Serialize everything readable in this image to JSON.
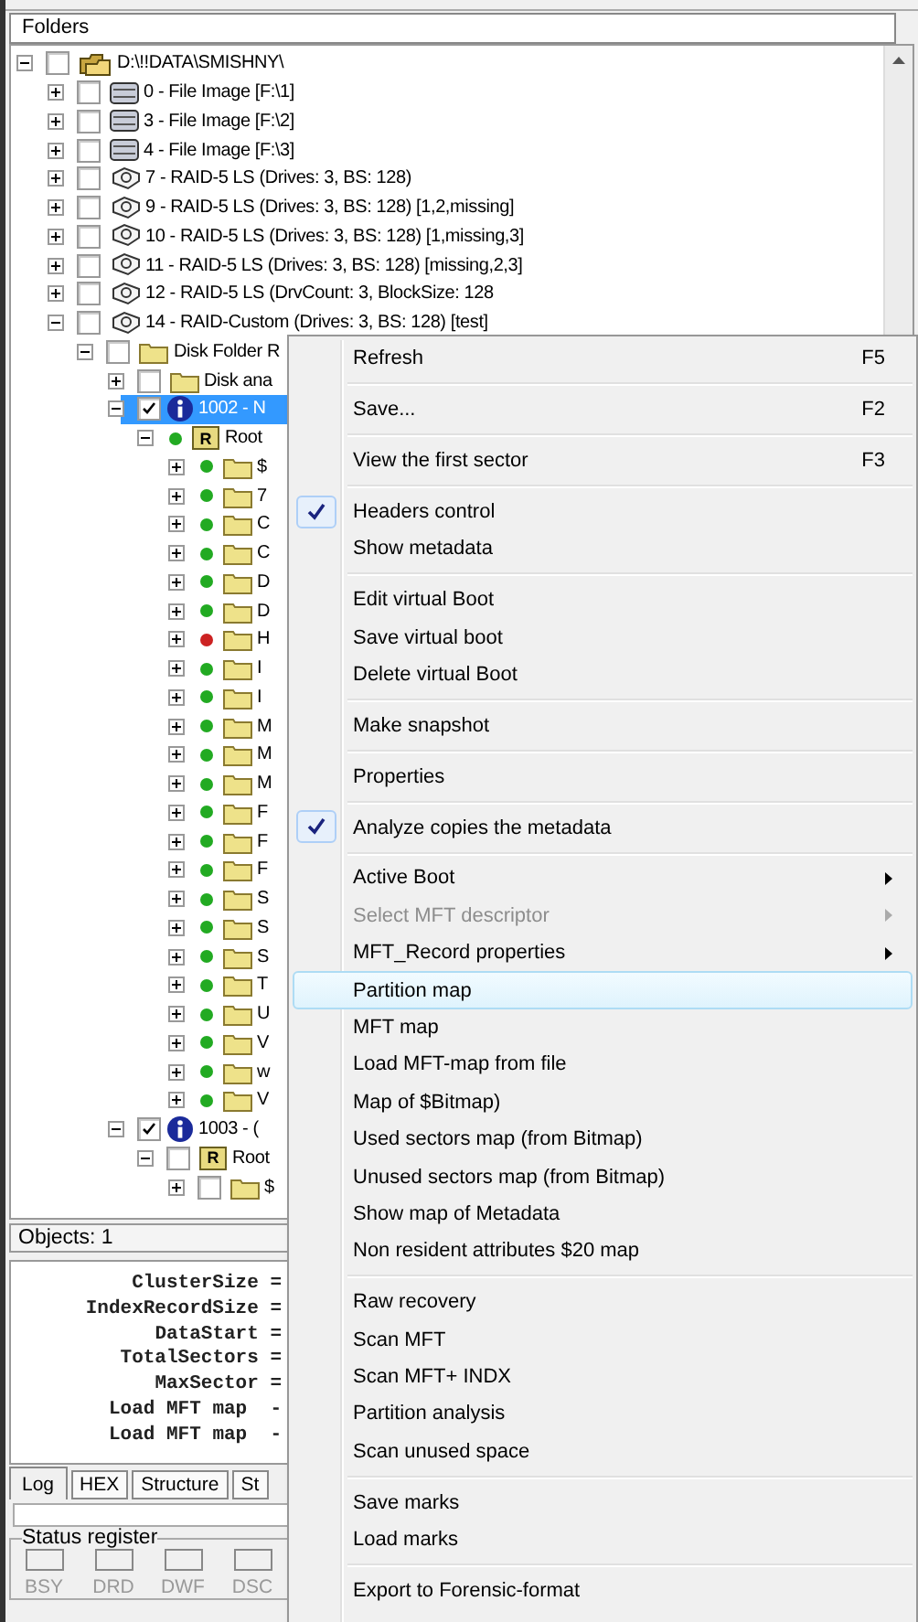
{
  "header": {
    "title": "Folders"
  },
  "tree": [
    {
      "label": "D:\\!!DATA\\SMISHNY\\",
      "kind": "images",
      "expanded": true,
      "checked": false,
      "selected": false,
      "children": [
        {
          "label": "0 - File Image [F:\\1]",
          "kind": "disk",
          "expanded": false,
          "checked": false,
          "selected": false
        },
        {
          "label": "3 - File Image [F:\\2]",
          "kind": "disk",
          "expanded": false,
          "checked": false,
          "selected": false
        },
        {
          "label": "4 - File Image [F:\\3]",
          "kind": "disk",
          "expanded": false,
          "checked": false,
          "selected": false
        },
        {
          "label": "7 - RAID-5 LS (Drives: 3, BS: 128)",
          "kind": "raid",
          "expanded": false,
          "checked": false,
          "selected": false
        },
        {
          "label": "9 - RAID-5 LS (Drives: 3, BS: 128) [1,2,missing]",
          "kind": "raid",
          "expanded": false,
          "checked": false,
          "selected": false
        },
        {
          "label": "10 - RAID-5 LS (Drives: 3, BS: 128) [1,missing,3]",
          "kind": "raid",
          "expanded": false,
          "checked": false,
          "selected": false
        },
        {
          "label": "11 - RAID-5 LS (Drives: 3, BS: 128) [missing,2,3]",
          "kind": "raid",
          "expanded": false,
          "checked": false,
          "selected": false
        },
        {
          "label": "12 - RAID-5 LS (DrvCount: 3, BlockSize: 128",
          "kind": "raid",
          "expanded": false,
          "checked": false,
          "selected": false
        },
        {
          "label": "14 - RAID-Custom (Drives: 3, BS: 128) [test]",
          "kind": "raid",
          "expanded": true,
          "checked": false,
          "selected": false,
          "children": [
            {
              "label": "Disk Folder R",
              "kind": "folder",
              "expanded": true,
              "checked": false,
              "selected": false,
              "children": [
                {
                  "label": "Disk ana",
                  "kind": "folder",
                  "expanded": false,
                  "checked": false,
                  "selected": false
                },
                {
                  "label": "1002 - N",
                  "kind": "info",
                  "expanded": true,
                  "checked": true,
                  "selected": true,
                  "children": [
                    {
                      "label": "Root",
                      "kind": "root",
                      "badge": "R",
                      "expanded": true,
                      "color": "#22aa22",
                      "selected": false,
                      "children": [
                        {
                          "label": "$",
                          "kind": "folder",
                          "expanded": false,
                          "color": "#22aa22",
                          "selected": false
                        },
                        {
                          "label": "7",
                          "kind": "folder",
                          "expanded": false,
                          "color": "#22aa22",
                          "selected": false
                        },
                        {
                          "label": "C",
                          "kind": "folder",
                          "expanded": false,
                          "color": "#22aa22",
                          "selected": false
                        },
                        {
                          "label": "C",
                          "kind": "folder",
                          "expanded": false,
                          "color": "#22aa22",
                          "selected": false
                        },
                        {
                          "label": "D",
                          "kind": "folder",
                          "expanded": false,
                          "color": "#22aa22",
                          "selected": false
                        },
                        {
                          "label": "D",
                          "kind": "folder",
                          "expanded": false,
                          "color": "#22aa22",
                          "selected": false
                        },
                        {
                          "label": "H",
                          "kind": "folder",
                          "expanded": false,
                          "color": "#cc2222",
                          "selected": false
                        },
                        {
                          "label": "I",
                          "kind": "folder",
                          "expanded": false,
                          "color": "#22aa22",
                          "selected": false
                        },
                        {
                          "label": "I",
                          "kind": "folder",
                          "expanded": false,
                          "color": "#22aa22",
                          "selected": false
                        },
                        {
                          "label": "M",
                          "kind": "folder",
                          "expanded": false,
                          "color": "#22aa22",
                          "selected": false
                        },
                        {
                          "label": "M",
                          "kind": "folder",
                          "expanded": false,
                          "color": "#22aa22",
                          "selected": false
                        },
                        {
                          "label": "M",
                          "kind": "folder",
                          "expanded": false,
                          "color": "#22aa22",
                          "selected": false
                        },
                        {
                          "label": "F",
                          "kind": "folder",
                          "expanded": false,
                          "color": "#22aa22",
                          "selected": false
                        },
                        {
                          "label": "F",
                          "kind": "folder",
                          "expanded": false,
                          "color": "#22aa22",
                          "selected": false
                        },
                        {
                          "label": "F",
                          "kind": "folder",
                          "expanded": false,
                          "color": "#22aa22",
                          "selected": false
                        },
                        {
                          "label": "S",
                          "kind": "folder",
                          "expanded": false,
                          "color": "#22aa22",
                          "selected": false
                        },
                        {
                          "label": "S",
                          "kind": "folder",
                          "expanded": false,
                          "color": "#22aa22",
                          "selected": false
                        },
                        {
                          "label": "S",
                          "kind": "folder",
                          "expanded": false,
                          "color": "#22aa22",
                          "selected": false
                        },
                        {
                          "label": "T",
                          "kind": "folder",
                          "expanded": false,
                          "color": "#22aa22",
                          "selected": false
                        },
                        {
                          "label": "U",
                          "kind": "folder",
                          "expanded": false,
                          "color": "#22aa22",
                          "selected": false
                        },
                        {
                          "label": "V",
                          "kind": "folder",
                          "expanded": false,
                          "color": "#22aa22",
                          "selected": false
                        },
                        {
                          "label": "w",
                          "kind": "folder",
                          "expanded": false,
                          "color": "#22aa22",
                          "selected": false
                        },
                        {
                          "label": "V",
                          "kind": "folder",
                          "expanded": false,
                          "color": "#22aa22",
                          "selected": false
                        }
                      ]
                    }
                  ]
                },
                {
                  "label": "1003 - (",
                  "kind": "info",
                  "expanded": true,
                  "checked": true,
                  "selected": false,
                  "children": [
                    {
                      "label": "Root",
                      "kind": "root",
                      "badge": "R",
                      "expanded": true,
                      "checked": false,
                      "selected": false,
                      "children": [
                        {
                          "label": "$",
                          "kind": "folder",
                          "expanded": false,
                          "checked": false,
                          "selected": false
                        }
                      ]
                    }
                  ]
                }
              ]
            }
          ]
        }
      ]
    }
  ],
  "objects": "Objects: 1",
  "log": [
    "ClusterSize =",
    "IndexRecordSize =",
    "DataStart =",
    "TotalSectors =",
    "MaxSector =",
    "Load MFT map  -",
    "Load MFT map  -"
  ],
  "tabs": [
    {
      "label": "Log",
      "selected": true
    },
    {
      "label": "HEX",
      "selected": false
    },
    {
      "label": "Structure",
      "selected": false
    },
    {
      "label": "St",
      "selected": false
    }
  ],
  "status_register": {
    "title": "Status register",
    "flags": [
      {
        "label": "BSY",
        "on": false
      },
      {
        "label": "DRD",
        "on": false
      },
      {
        "label": "DWF",
        "on": false
      },
      {
        "label": "DSC",
        "on": false
      }
    ]
  },
  "menu": [
    {
      "kind": "item",
      "label": "Refresh",
      "shortcut": "F5",
      "checked": false,
      "disabled": false,
      "submenu": false,
      "selected": false
    },
    {
      "kind": "separator"
    },
    {
      "kind": "item",
      "label": "Save...",
      "shortcut": "F2",
      "checked": false,
      "disabled": false,
      "submenu": false,
      "selected": false
    },
    {
      "kind": "separator"
    },
    {
      "kind": "item",
      "label": "View the first sector",
      "shortcut": "F3",
      "checked": false,
      "disabled": false,
      "submenu": false,
      "selected": false
    },
    {
      "kind": "separator"
    },
    {
      "kind": "item",
      "label": "Headers control",
      "checked": true,
      "disabled": false,
      "submenu": false,
      "selected": false
    },
    {
      "kind": "item",
      "label": "Show metadata",
      "checked": false,
      "disabled": false,
      "submenu": false,
      "selected": false
    },
    {
      "kind": "separator"
    },
    {
      "kind": "item",
      "label": "Edit virtual Boot",
      "checked": false,
      "disabled": false,
      "submenu": false,
      "selected": false
    },
    {
      "kind": "item",
      "label": "Save virtual boot",
      "checked": false,
      "disabled": false,
      "submenu": false,
      "selected": false
    },
    {
      "kind": "item",
      "label": "Delete virtual Boot",
      "checked": false,
      "disabled": false,
      "submenu": false,
      "selected": false
    },
    {
      "kind": "separator"
    },
    {
      "kind": "item",
      "label": "Make snapshot",
      "checked": false,
      "disabled": false,
      "submenu": false,
      "selected": false
    },
    {
      "kind": "separator"
    },
    {
      "kind": "item",
      "label": "Properties",
      "checked": false,
      "disabled": false,
      "submenu": false,
      "selected": false
    },
    {
      "kind": "separator"
    },
    {
      "kind": "item",
      "label": "Analyze copies the metadata",
      "checked": true,
      "disabled": false,
      "submenu": false,
      "selected": false
    },
    {
      "kind": "separator"
    },
    {
      "kind": "item",
      "label": "Active Boot",
      "checked": false,
      "disabled": false,
      "submenu": true,
      "selected": false
    },
    {
      "kind": "item",
      "label": "Select MFT descriptor",
      "checked": false,
      "disabled": true,
      "submenu": true,
      "selected": false
    },
    {
      "kind": "item",
      "label": "MFT_Record properties",
      "checked": false,
      "disabled": false,
      "submenu": true,
      "selected": false
    },
    {
      "kind": "item",
      "label": "Partition map",
      "checked": false,
      "disabled": false,
      "submenu": false,
      "selected": true
    },
    {
      "kind": "item",
      "label": "MFT map",
      "checked": false,
      "disabled": false,
      "submenu": false,
      "selected": false
    },
    {
      "kind": "item",
      "label": "Load MFT-map from file",
      "checked": false,
      "disabled": false,
      "submenu": false,
      "selected": false
    },
    {
      "kind": "item",
      "label": "Map of $Bitmap)",
      "checked": false,
      "disabled": false,
      "submenu": false,
      "selected": false
    },
    {
      "kind": "item",
      "label": "Used sectors map (from Bitmap)",
      "checked": false,
      "disabled": false,
      "submenu": false,
      "selected": false
    },
    {
      "kind": "item",
      "label": "Unused sectors map (from Bitmap)",
      "checked": false,
      "disabled": false,
      "submenu": false,
      "selected": false
    },
    {
      "kind": "item",
      "label": "Show map of Metadata",
      "checked": false,
      "disabled": false,
      "submenu": false,
      "selected": false
    },
    {
      "kind": "item",
      "label": "Non resident attributes $20 map",
      "checked": false,
      "disabled": false,
      "submenu": false,
      "selected": false
    },
    {
      "kind": "separator"
    },
    {
      "kind": "item",
      "label": "Raw recovery",
      "checked": false,
      "disabled": false,
      "submenu": false,
      "selected": false
    },
    {
      "kind": "item",
      "label": "Scan MFT",
      "checked": false,
      "disabled": false,
      "submenu": false,
      "selected": false
    },
    {
      "kind": "item",
      "label": "Scan MFT+ INDX",
      "checked": false,
      "disabled": false,
      "submenu": false,
      "selected": false
    },
    {
      "kind": "item",
      "label": "Partition analysis",
      "checked": false,
      "disabled": false,
      "submenu": false,
      "selected": false
    },
    {
      "kind": "item",
      "label": "Scan unused space",
      "checked": false,
      "disabled": false,
      "submenu": false,
      "selected": false
    },
    {
      "kind": "separator"
    },
    {
      "kind": "item",
      "label": "Save marks",
      "checked": false,
      "disabled": false,
      "submenu": false,
      "selected": false
    },
    {
      "kind": "item",
      "label": "Load marks",
      "checked": false,
      "disabled": false,
      "submenu": false,
      "selected": false
    },
    {
      "kind": "separator"
    },
    {
      "kind": "item",
      "label": "Export to Forensic-format",
      "checked": false,
      "disabled": false,
      "submenu": false,
      "selected": false
    }
  ]
}
